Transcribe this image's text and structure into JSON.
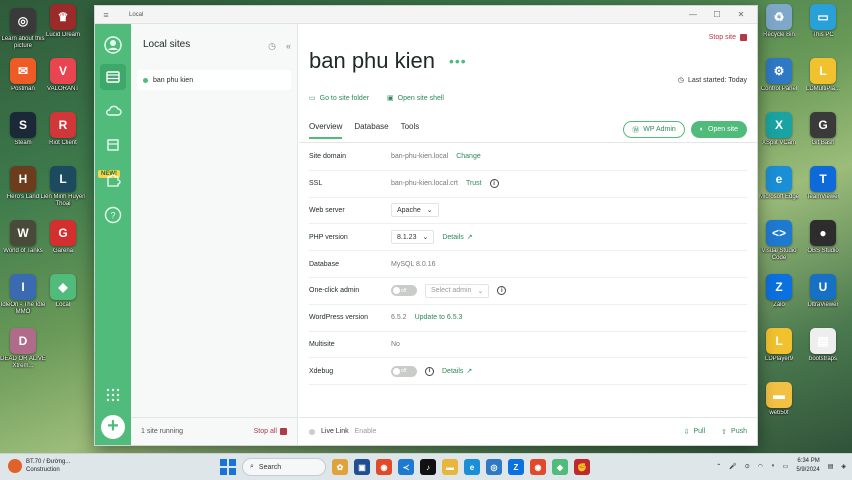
{
  "desktop": {
    "left_icons": [
      {
        "label": "Learn about this picture",
        "color": "#3a3a3a",
        "glyph": "◎"
      },
      {
        "label": "Lucid Dream",
        "color": "#9b2b2b",
        "glyph": "♛"
      },
      {
        "label": "Postman",
        "color": "#ef5b25",
        "glyph": "✉"
      },
      {
        "label": "VALORANT",
        "color": "#e84550",
        "glyph": "V"
      },
      {
        "label": "Steam",
        "color": "#1b2838",
        "glyph": "S"
      },
      {
        "label": "Riot Client",
        "color": "#d13639",
        "glyph": "R"
      },
      {
        "label": "Hero's Land",
        "color": "#6b3d1c",
        "glyph": "H"
      },
      {
        "label": "Liên Minh Huyền Thoại",
        "color": "#1d4a5e",
        "glyph": "L"
      },
      {
        "label": "World of Tanks",
        "color": "#4a4a3a",
        "glyph": "W"
      },
      {
        "label": "Garena",
        "color": "#d32f2f",
        "glyph": "G"
      },
      {
        "label": "IdleOn - The Idle MMO",
        "color": "#3a6bb0",
        "glyph": "I"
      },
      {
        "label": "Local",
        "color": "#51bb7b",
        "glyph": "◆"
      },
      {
        "label": "DEAD OR ALIVE Xtrem...",
        "color": "#b06a8a",
        "glyph": "D"
      }
    ],
    "right_icons": [
      {
        "label": "Recycle Bin",
        "color": "#7fa7c9",
        "glyph": "♻"
      },
      {
        "label": "This PC",
        "color": "#2aa0d8",
        "glyph": "▭"
      },
      {
        "label": "Control Panel",
        "color": "#2f78c4",
        "glyph": "⚙"
      },
      {
        "label": "LDMultiPla...",
        "color": "#f2c12e",
        "glyph": "L"
      },
      {
        "label": "XSplit VCam",
        "color": "#1aa3a3",
        "glyph": "X"
      },
      {
        "label": "Git Bash",
        "color": "#3a3a3a",
        "glyph": "G"
      },
      {
        "label": "Microsoft Edge",
        "color": "#1a8fd6",
        "glyph": "e"
      },
      {
        "label": "TeamViewer",
        "color": "#0e6ad8",
        "glyph": "T"
      },
      {
        "label": "Visual Studio Code",
        "color": "#1e7ad0",
        "glyph": "<>"
      },
      {
        "label": "OBS Studio",
        "color": "#2d2d2d",
        "glyph": "●"
      },
      {
        "label": "Zalo",
        "color": "#0b70e0",
        "glyph": "Z"
      },
      {
        "label": "UltraViewer",
        "color": "#1670c4",
        "glyph": "U"
      },
      {
        "label": "LDPlayer9",
        "color": "#f2c12e",
        "glyph": "L"
      },
      {
        "label": "bootstraps",
        "color": "#eeeeee",
        "glyph": "▤"
      },
      {
        "label": "web50f",
        "color": "#f2c144",
        "glyph": "▬"
      }
    ]
  },
  "window": {
    "title": "Local",
    "controls": {
      "minimize": "—",
      "maximize": "☐",
      "close": "✕"
    }
  },
  "sidebar": {
    "heading": "Local sites",
    "sites": [
      {
        "name": "ban phu kien",
        "running": true
      }
    ],
    "footer_status": "1 site running",
    "stop_all_label": "Stop all",
    "new_badge": "NEW!"
  },
  "site": {
    "name": "ban phu kien",
    "stop_label": "Stop site",
    "go_to_folder": "Go to site folder",
    "open_shell": "Open site shell",
    "last_started": "Last started: Today",
    "tabs": [
      "Overview",
      "Database",
      "Tools"
    ],
    "wp_admin_label": "WP Admin",
    "open_site_label": "Open site",
    "fields": {
      "site_domain": {
        "key": "Site domain",
        "value": "ban-phu-kien.local",
        "action": "Change"
      },
      "ssl": {
        "key": "SSL",
        "value": "ban-phu-kien.local.crt",
        "action": "Trust"
      },
      "web_server": {
        "key": "Web server",
        "value": "Apache"
      },
      "php_version": {
        "key": "PHP version",
        "value": "8.1.23",
        "action": "Details"
      },
      "database": {
        "key": "Database",
        "value": "MySQL 8.0.16"
      },
      "one_click_admin": {
        "key": "One-click admin",
        "toggle": "off",
        "select_placeholder": "Select admin"
      },
      "wordpress_version": {
        "key": "WordPress version",
        "value": "6.5.2",
        "action": "Update to 6.5.3"
      },
      "multisite": {
        "key": "Multisite",
        "value": "No"
      },
      "xdebug": {
        "key": "Xdebug",
        "toggle": "off",
        "action": "Details"
      }
    },
    "live_link_label": "Live Link",
    "live_link_action": "Enable",
    "pull_label": "Pull",
    "push_label": "Push"
  },
  "taskbar": {
    "weather_line1": "BT.70 / Đường...",
    "weather_line2": "Construction",
    "search_placeholder": "Search",
    "time": "6:34 PM",
    "date": "5/9/2024"
  }
}
